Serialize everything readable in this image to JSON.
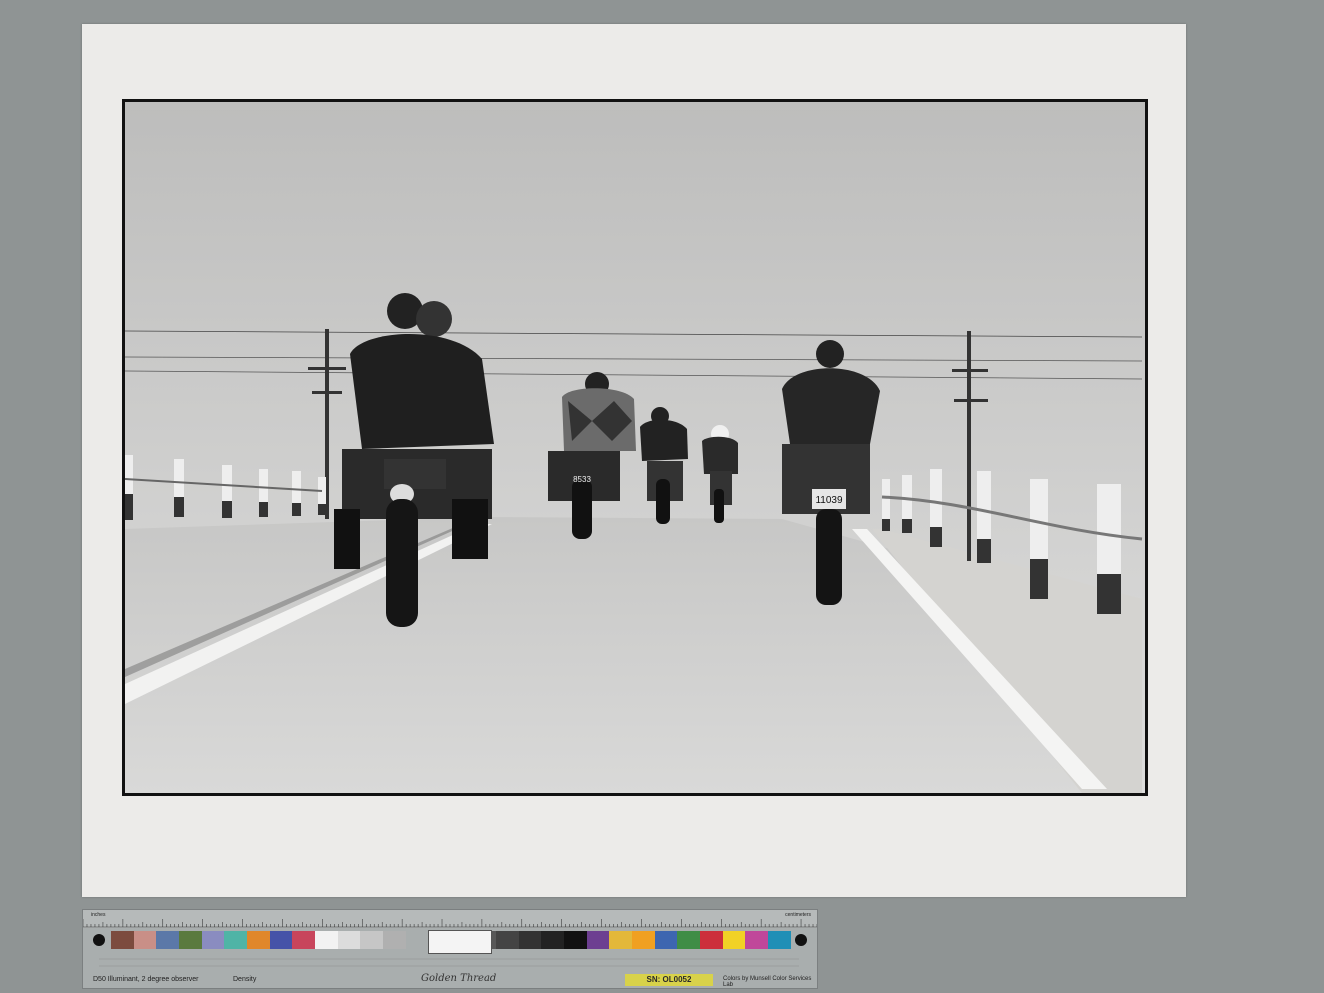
{
  "target": {
    "label_inches": "inches",
    "label_centimeters": "centimeters",
    "illuminant": "D50 Illuminant, 2 degree observer",
    "density_label": "Density",
    "brand": "Golden Thread",
    "serial": "SN: OL0052",
    "credit": "Colors by Munsell Color Services Lab",
    "patch_colors": [
      "#7c4b3e",
      "#c98f87",
      "#5b78a8",
      "#5a7a3e",
      "#8a8cc0",
      "#4fb4a6",
      "#e0872a",
      "#4553a8",
      "#c8455c",
      "#f2f2f2",
      "#dcdcdc",
      "#c6c6c6",
      "#b0b0b0",
      "#9a9a9a",
      "#848484",
      "#6e6e6e",
      "#585858",
      "#444444",
      "#333333",
      "#222222",
      "#111111",
      "#6d3f91",
      "#e3b83a",
      "#f0a021",
      "#3d66b0",
      "#3f8d46",
      "#cc2f3b",
      "#f1d226",
      "#c0479a",
      "#1f8fb6"
    ]
  },
  "photo": {
    "plate_left": "11039",
    "plate_mid": "8533"
  }
}
